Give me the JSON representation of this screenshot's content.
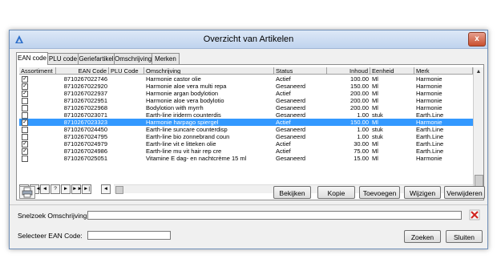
{
  "window": {
    "title": "Overzicht van Artikelen",
    "close_glyph": "x"
  },
  "tabs": [
    {
      "label": "EAN code"
    },
    {
      "label": "PLU code"
    },
    {
      "label": "Geriefartikel"
    },
    {
      "label": "Omschrijving"
    },
    {
      "label": "Merken"
    }
  ],
  "grid": {
    "columns": [
      "Assortiment",
      "EAN Code",
      "PLU Code",
      "Omschrijving",
      "Status",
      "Inhoud",
      "Eenheid",
      "Merk"
    ],
    "rows": [
      {
        "checked": true,
        "ean": "8710267022746",
        "plu": "",
        "desc": "Harmonie castor olie",
        "status": "Actief",
        "inhoud": "100.00",
        "eenheid": "Ml",
        "merk": "Harmonie"
      },
      {
        "checked": true,
        "ean": "8710267022920",
        "plu": "",
        "desc": "Harmonie aloe vera multi repa",
        "status": "Gesaneerd",
        "inhoud": "150.00",
        "eenheid": "Ml",
        "merk": "Harmonie"
      },
      {
        "checked": true,
        "ean": "8710267022937",
        "plu": "",
        "desc": "Harmonie argan bodylotion",
        "status": "Actief",
        "inhoud": "200.00",
        "eenheid": "Ml",
        "merk": "Harmonie"
      },
      {
        "checked": false,
        "ean": "8710267022951",
        "plu": "",
        "desc": "Harmonie aloe vera bodylotio",
        "status": "Gesaneerd",
        "inhoud": "200.00",
        "eenheid": "Ml",
        "merk": "Harmonie"
      },
      {
        "checked": false,
        "ean": "8710267022968",
        "plu": "",
        "desc": "Bodylotion with myrrh",
        "status": "Gesaneerd",
        "inhoud": "200.00",
        "eenheid": "Ml",
        "merk": "Harmonie"
      },
      {
        "checked": false,
        "ean": "8710267023071",
        "plu": "",
        "desc": "Earth-line iriderm counterdis",
        "status": "Gesaneerd",
        "inhoud": "1.00",
        "eenheid": "stuk",
        "merk": "Earth.Line"
      },
      {
        "checked": true,
        "ean": "8710267023323",
        "plu": "",
        "desc": "Harmonie harpago spiergel",
        "status": "Actief",
        "inhoud": "150.00",
        "eenheid": "Ml",
        "merk": "Harmonie",
        "selected": true
      },
      {
        "checked": false,
        "ean": "8710267024450",
        "plu": "",
        "desc": "Earth-line suncare counterdisp",
        "status": "Gesaneerd",
        "inhoud": "1.00",
        "eenheid": "stuk",
        "merk": "Earth.Line"
      },
      {
        "checked": false,
        "ean": "8710267024795",
        "plu": "",
        "desc": "Earth-line bio zonnebrand coun",
        "status": "Gesaneerd",
        "inhoud": "1.00",
        "eenheid": "stuk",
        "merk": "Earth.Line"
      },
      {
        "checked": true,
        "ean": "8710267024979",
        "plu": "",
        "desc": "Earth-line vit e litteken olie",
        "status": "Actief",
        "inhoud": "30.00",
        "eenheid": "Ml",
        "merk": "Earth.Line"
      },
      {
        "checked": true,
        "ean": "8710267024986",
        "plu": "",
        "desc": "Earth-line mu vit hair rep cre",
        "status": "Actief",
        "inhoud": "75.00",
        "eenheid": "Ml",
        "merk": "Earth.Line"
      },
      {
        "checked": false,
        "ean": "8710267025051",
        "plu": "",
        "desc": "Vitamine E dag- en nachtcrème 15 ml",
        "status": "Gesaneerd",
        "inhoud": "15.00",
        "eenheid": "Ml",
        "merk": "Harmonie"
      }
    ]
  },
  "navigator": [
    "|◄",
    "◄◄",
    "◄",
    "?",
    "►",
    "►►",
    "►|"
  ],
  "buttons": {
    "bekijken": "Bekijken",
    "kopie": "Kopie",
    "toevoegen": "Toevoegen",
    "wijzigen": "Wijzigen",
    "verwijderen": "Verwijderen",
    "zoeken": "Zoeken",
    "sluiten": "Sluiten"
  },
  "search": {
    "label": "Snelzoek Omschrijving:",
    "value": ""
  },
  "ean_select": {
    "label": "Selecteer EAN Code:",
    "value": ""
  },
  "icons": {
    "app": "app-logo-icon",
    "print": "printer-icon",
    "clear": "clear-search-icon"
  }
}
